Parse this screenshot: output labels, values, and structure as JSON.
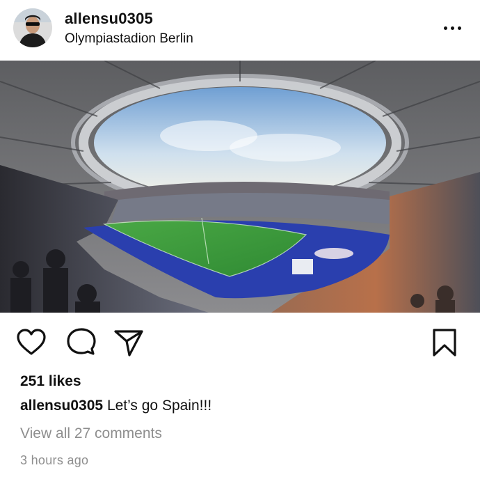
{
  "post": {
    "username": "allensu0305",
    "location": "Olympiastadion Berlin",
    "likes": "251 likes",
    "caption_user": "allensu0305",
    "caption_text": "Let’s go Spain!!!",
    "view_comments": "View all 27 comments",
    "timestamp": "3 hours ago"
  },
  "icons": {
    "more": "more-options-icon",
    "like": "heart-icon",
    "comment": "comment-icon",
    "share": "paper-plane-icon",
    "save": "bookmark-icon"
  },
  "colors": {
    "text": "#111111",
    "secondary_text": "#8e8e8e",
    "pitch": "#3f9a3a",
    "track": "#2a3fae"
  }
}
